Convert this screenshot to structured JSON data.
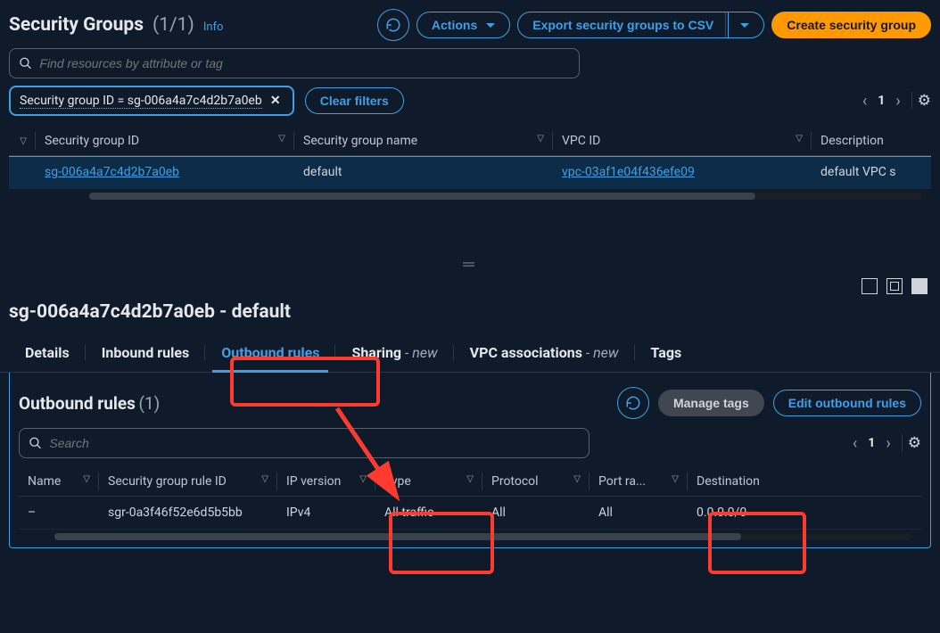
{
  "top": {
    "title": "Security Groups",
    "count": "(1/1)",
    "info": "Info",
    "actions_label": "Actions",
    "export_label": "Export security groups to CSV",
    "create_label": "Create security group",
    "search_placeholder": "Find resources by attribute or tag",
    "filter_tag": "Security group ID = sg-006a4a7c4d2b7a0eb",
    "clear_filters": "Clear filters",
    "page_num": "1",
    "columns": {
      "id": "Security group ID",
      "name": "Security group name",
      "vpc": "VPC ID",
      "desc": "Description"
    },
    "row": {
      "id": "sg-006a4a7c4d2b7a0eb",
      "name": "default",
      "vpc": "vpc-03af1e04f436efe09",
      "desc": "default VPC s"
    }
  },
  "detail": {
    "title": "sg-006a4a7c4d2b7a0eb - default",
    "tabs": {
      "details": "Details",
      "inbound": "Inbound rules",
      "outbound": "Outbound rules",
      "sharing": "Sharing",
      "sharing_new": " - new",
      "vpc_assoc": "VPC associations",
      "vpc_assoc_new": " - new",
      "tags": "Tags"
    }
  },
  "outbound": {
    "title": "Outbound rules",
    "count": "(1)",
    "manage_tags": "Manage tags",
    "edit_rules": "Edit outbound rules",
    "search_placeholder": "Search",
    "page_num": "1",
    "columns": {
      "name": "Name",
      "rule_id": "Security group rule ID",
      "ipver": "IP version",
      "type": "Type",
      "protocol": "Protocol",
      "port": "Port ra...",
      "dest": "Destination"
    },
    "row": {
      "name": "–",
      "rule_id": "sgr-0a3f46f52e6d5b5bb",
      "ipver": "IPv4",
      "type": "All traffic",
      "protocol": "All",
      "port": "All",
      "dest": "0.0.0.0/0"
    }
  }
}
